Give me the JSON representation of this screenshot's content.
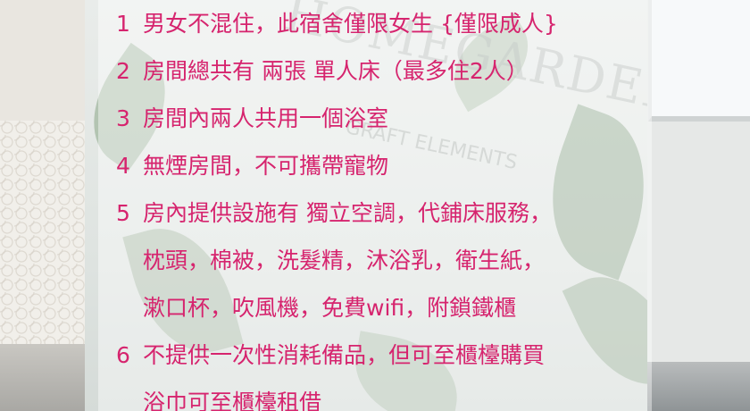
{
  "curtain_print": {
    "brand": "HOMEGARDEN",
    "sub": "GRAFT ELEMENTS"
  },
  "rules": [
    {
      "num": "1",
      "text": "男女不混住，此宿舍僅限女生 {僅限成人}"
    },
    {
      "num": "2",
      "text": "房間總共有 兩張 單人床（最多住2人）"
    },
    {
      "num": "3",
      "text": "房間內兩人共用一個浴室"
    },
    {
      "num": "4",
      "text": "無煙房間，不可攜帶寵物"
    },
    {
      "num": "5",
      "text": "房內提供設施有 獨立空調，代鋪床服務，"
    },
    {
      "num": "",
      "text": "枕頭，棉被，洗髮精，沐浴乳，衛生紙，"
    },
    {
      "num": "",
      "text": "漱口杯，吹風機，免費wifi，附鎖鐵櫃"
    },
    {
      "num": "6",
      "text": "不提供一次性消耗備品，但可至櫃檯購買"
    },
    {
      "num": "",
      "text": "浴巾可至櫃檯租借"
    }
  ]
}
